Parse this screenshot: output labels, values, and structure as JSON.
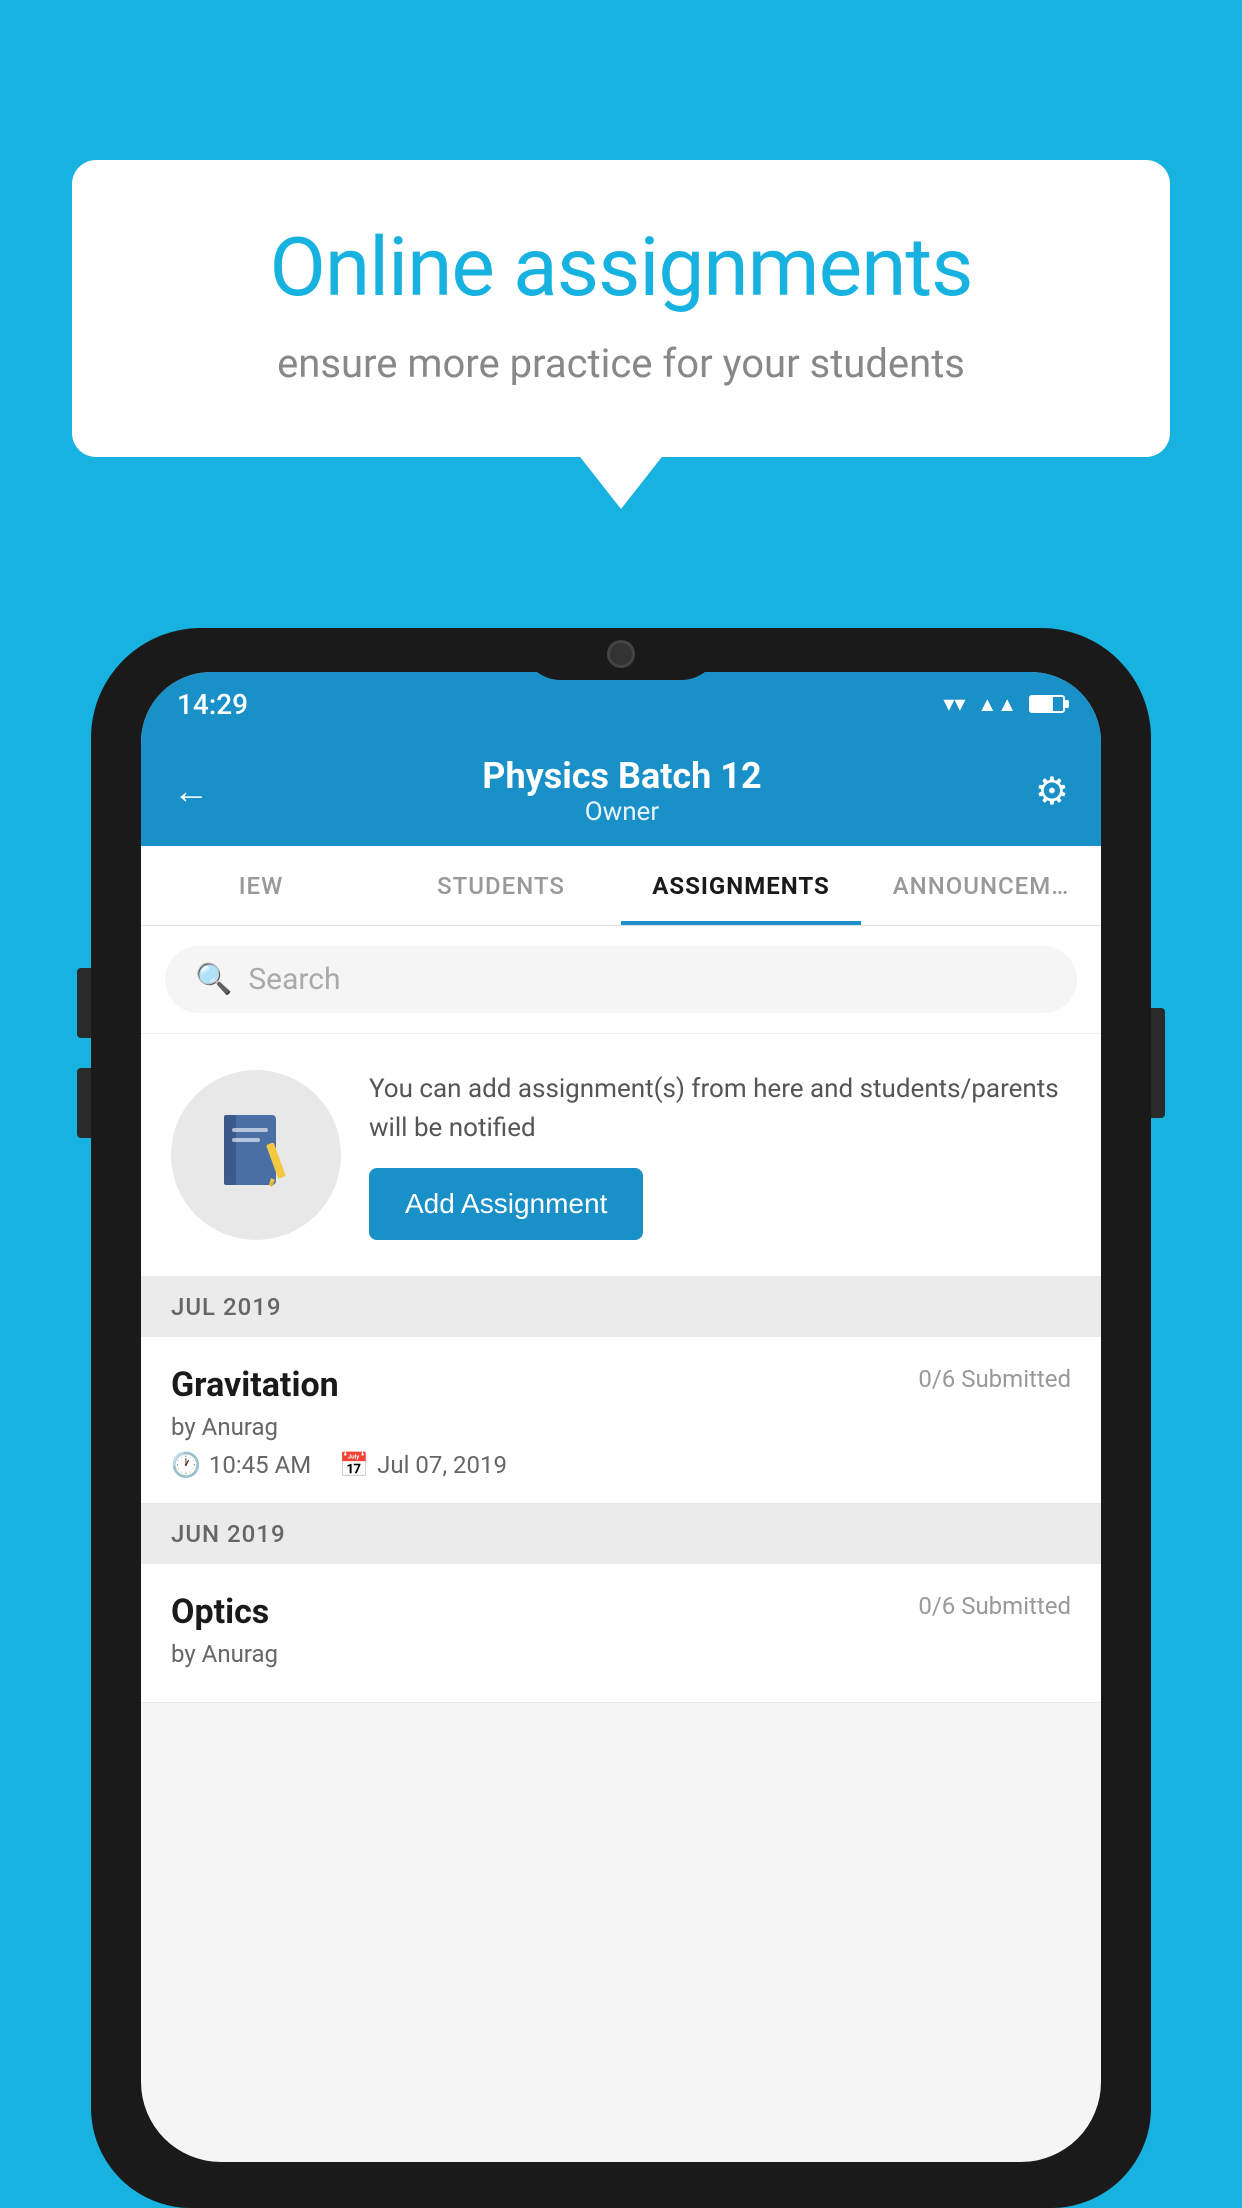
{
  "background_color": "#17b2e0",
  "speech_bubble": {
    "title": "Online assignments",
    "subtitle": "ensure more practice for your students"
  },
  "phone": {
    "status_bar": {
      "time": "14:29"
    },
    "header": {
      "title": "Physics Batch 12",
      "subtitle": "Owner",
      "back_label": "←",
      "settings_label": "⚙"
    },
    "tabs": [
      {
        "label": "IEW",
        "active": false
      },
      {
        "label": "STUDENTS",
        "active": false
      },
      {
        "label": "ASSIGNMENTS",
        "active": true
      },
      {
        "label": "ANNOUNCEM…",
        "active": false
      }
    ],
    "search": {
      "placeholder": "Search"
    },
    "promo": {
      "description": "You can add assignment(s) from here and students/parents will be notified",
      "button_label": "Add Assignment"
    },
    "sections": [
      {
        "label": "JUL 2019",
        "assignments": [
          {
            "name": "Gravitation",
            "submitted": "0/6 Submitted",
            "by": "by Anurag",
            "time": "10:45 AM",
            "date": "Jul 07, 2019"
          }
        ]
      },
      {
        "label": "JUN 2019",
        "assignments": [
          {
            "name": "Optics",
            "submitted": "0/6 Submitted",
            "by": "by Anurag",
            "time": "",
            "date": ""
          }
        ]
      }
    ]
  }
}
